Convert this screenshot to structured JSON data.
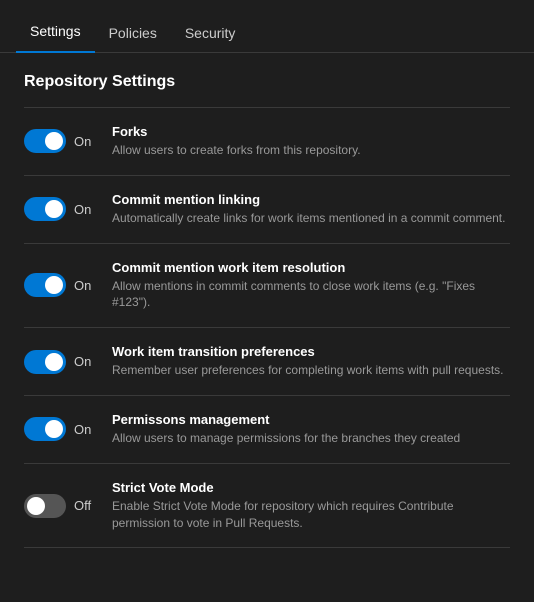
{
  "nav": {
    "tabs": [
      {
        "id": "settings",
        "label": "Settings",
        "active": true
      },
      {
        "id": "policies",
        "label": "Policies",
        "active": false
      },
      {
        "id": "security",
        "label": "Security",
        "active": false
      }
    ]
  },
  "main": {
    "section_title": "Repository Settings",
    "settings": [
      {
        "id": "forks",
        "name": "Forks",
        "description": "Allow users to create forks from this repository.",
        "enabled": true,
        "label_on": "On",
        "label_off": "Off"
      },
      {
        "id": "commit-mention-linking",
        "name": "Commit mention linking",
        "description": "Automatically create links for work items mentioned in a commit comment.",
        "enabled": true,
        "label_on": "On",
        "label_off": "Off"
      },
      {
        "id": "commit-mention-work-item",
        "name": "Commit mention work item resolution",
        "description": "Allow mentions in commit comments to close work items (e.g. \"Fixes #123\").",
        "enabled": true,
        "label_on": "On",
        "label_off": "Off"
      },
      {
        "id": "work-item-transition",
        "name": "Work item transition preferences",
        "description": "Remember user preferences for completing work items with pull requests.",
        "enabled": true,
        "label_on": "On",
        "label_off": "Off"
      },
      {
        "id": "permissions-management",
        "name": "Permissons management",
        "description": "Allow users to manage permissions for the branches they created",
        "enabled": true,
        "label_on": "On",
        "label_off": "Off"
      },
      {
        "id": "strict-vote-mode",
        "name": "Strict Vote Mode",
        "description": "Enable Strict Vote Mode for repository which requires Contribute permission to vote in Pull Requests.",
        "enabled": false,
        "label_on": "On",
        "label_off": "Off"
      }
    ]
  }
}
